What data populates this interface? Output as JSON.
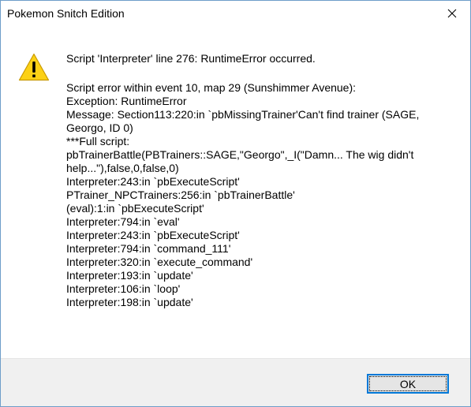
{
  "window": {
    "title": "Pokemon Snitch Edition"
  },
  "icons": {
    "warning": "warning-icon",
    "close": "close-icon"
  },
  "colors": {
    "warning_yellow": "#fcd116",
    "button_border": "#0078d7",
    "footer_bg": "#f0f0f0"
  },
  "dialog": {
    "headline": "Script 'Interpreter' line 276: RuntimeError occurred.",
    "lines": [
      "Script error within event 10, map 29 (Sunshimmer Avenue):",
      "Exception: RuntimeError",
      "Message: Section113:220:in `pbMissingTrainer'Can't find trainer (SAGE,",
      "Georgo, ID 0)",
      "***Full script:",
      "pbTrainerBattle(PBTrainers::SAGE,\"Georgo\",_I(\"Damn... The wig didn't",
      "help...\"),false,0,false,0)",
      "Interpreter:243:in `pbExecuteScript'",
      "PTrainer_NPCTrainers:256:in `pbTrainerBattle'",
      "(eval):1:in `pbExecuteScript'",
      "Interpreter:794:in `eval'",
      "Interpreter:243:in `pbExecuteScript'",
      "Interpreter:794:in `command_111'",
      "Interpreter:320:in `execute_command'",
      "Interpreter:193:in `update'",
      "Interpreter:106:in `loop'",
      "Interpreter:198:in `update'"
    ]
  },
  "footer": {
    "ok_label": "OK"
  }
}
